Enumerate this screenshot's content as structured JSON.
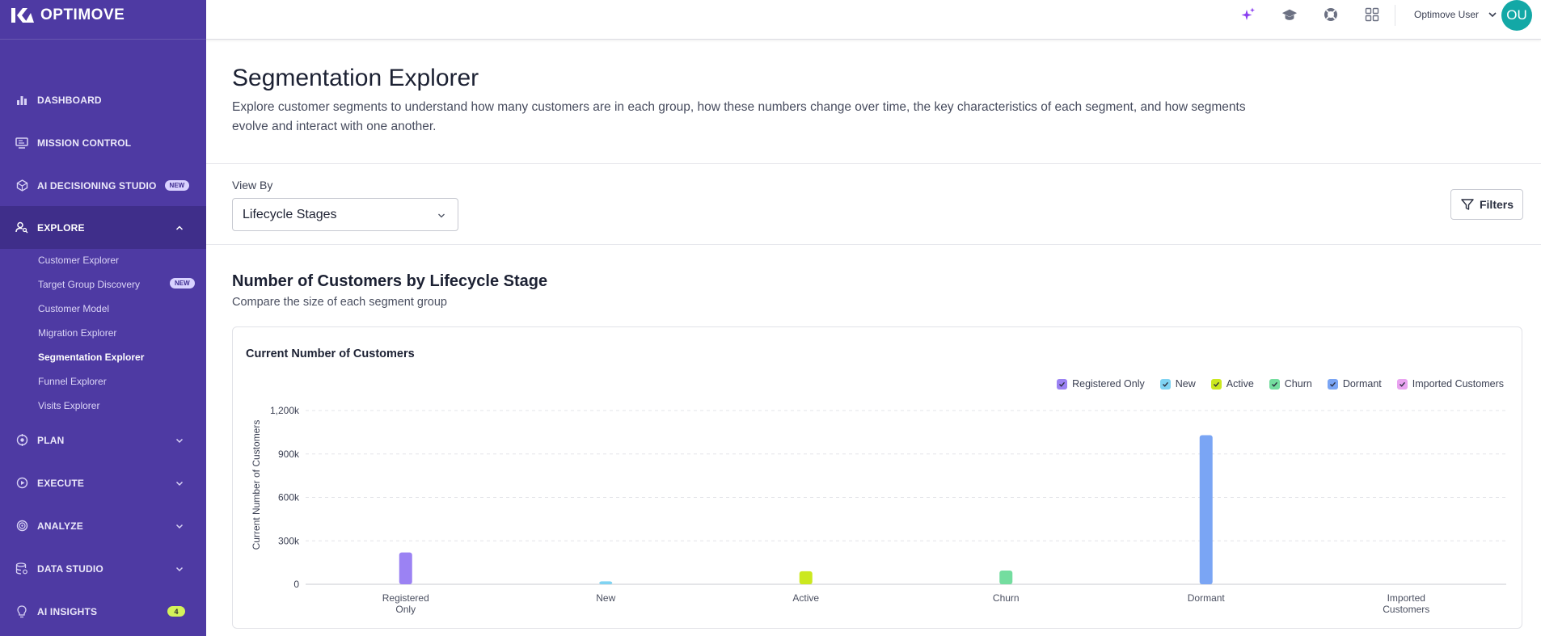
{
  "brand": {
    "name": "OPTIMOVE"
  },
  "sidebar": {
    "items": [
      {
        "label": "DASHBOARD",
        "icon": "bar-chart-icon"
      },
      {
        "label": "MISSION CONTROL",
        "icon": "monitor-icon"
      },
      {
        "label": "AI DECISIONING STUDIO",
        "icon": "cube-icon",
        "badge": "NEW"
      },
      {
        "label": "EXPLORE",
        "icon": "user-search-icon",
        "expanded": true
      },
      {
        "label": "PLAN",
        "icon": "target-icon"
      },
      {
        "label": "EXECUTE",
        "icon": "play-circle-icon"
      },
      {
        "label": "ANALYZE",
        "icon": "analyze-icon"
      },
      {
        "label": "DATA STUDIO",
        "icon": "database-icon"
      },
      {
        "label": "AI INSIGHTS",
        "icon": "lightbulb-icon",
        "count": "4"
      }
    ],
    "explore_sub": [
      {
        "label": "Customer Explorer"
      },
      {
        "label": "Target Group Discovery",
        "badge": "NEW"
      },
      {
        "label": "Customer Model"
      },
      {
        "label": "Migration Explorer"
      },
      {
        "label": "Segmentation Explorer",
        "current": true
      },
      {
        "label": "Funnel Explorer"
      },
      {
        "label": "Visits Explorer"
      }
    ]
  },
  "topbar": {
    "user_name": "Optimove User",
    "avatar_initials": "OU",
    "icons": [
      "sparkle-icon",
      "graduation-cap-icon",
      "help-icon",
      "apps-grid-icon"
    ]
  },
  "page": {
    "title": "Segmentation Explorer",
    "description": "Explore customer segments to understand how many customers are in each group, how these numbers change over time, the key characteristics of each segment, and how segments evolve and interact with one another.",
    "view_by_label": "View By",
    "view_by_value": "Lifecycle Stages",
    "filters_label": "Filters",
    "section_title": "Number of Customers by Lifecycle Stage",
    "section_subtitle": "Compare the size of each segment group",
    "card_title": "Current Number of Customers"
  },
  "colors": {
    "sidebar_bg": "#4e3aa3",
    "sidebar_active": "#3f2e8a",
    "accent_teal": "#13a8a6"
  },
  "chart_data": {
    "type": "bar",
    "title": "Current Number of Customers",
    "xlabel": "",
    "ylabel": "Current Number of Customers",
    "ylim": [
      0,
      1200000
    ],
    "y_ticks": [
      0,
      300000,
      600000,
      900000,
      1200000
    ],
    "y_tick_labels": [
      "0",
      "300k",
      "600k",
      "900k",
      "1,200k"
    ],
    "categories": [
      "Registered Only",
      "New",
      "Active",
      "Churn",
      "Dormant",
      "Imported Customers"
    ],
    "category_label_lines": [
      [
        "Registered",
        "Only"
      ],
      [
        "New"
      ],
      [
        "Active"
      ],
      [
        "Churn"
      ],
      [
        "Dormant"
      ],
      [
        "Imported",
        "Customers"
      ]
    ],
    "values": [
      220000,
      20000,
      90000,
      95000,
      1030000,
      0
    ],
    "colors": [
      "#9b82f3",
      "#7fd3f2",
      "#cbe81f",
      "#74dd9f",
      "#7aa5f4",
      "#e9a3f0"
    ],
    "legend": [
      "Registered Only",
      "New",
      "Active",
      "Churn",
      "Dormant",
      "Imported Customers"
    ],
    "legend_position": "top-right",
    "grid": true
  }
}
